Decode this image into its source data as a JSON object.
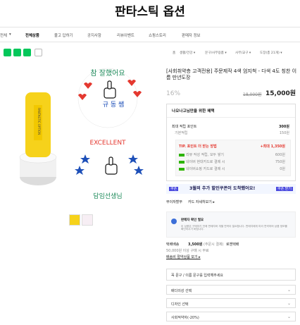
{
  "store": {
    "title": "판타스틱 옵션"
  },
  "nav": [
    "전체상품",
    "불고 답하기",
    "공지사항",
    "리뷰이벤트",
    "쇼핑스토리",
    "판매자 정보"
  ],
  "nav_left": "전체",
  "share_icons": [
    "share-icon",
    "talk-icon",
    "shopping-icon",
    "refresh-icon"
  ],
  "breadcrumb": {
    "home": "홈",
    "items": [
      "생활/건강 ▾",
      "문구/사무용품 ▾",
      "사무/교구 ▾",
      "도장(총 21개) ▾"
    ]
  },
  "image_text": {
    "top": "참 잘했어요",
    "middle": "규 동 쌤",
    "bottom_en": "EXCELLENT",
    "bottom_ko": "담임선생님",
    "stamp_label": "FANTASTIC OPTION"
  },
  "product": {
    "title": "[사회취약층 고객전용] 주문제작 4색 엄지척 - 다색 4도 칭찬 이름 만년도장",
    "discount": "16%",
    "original_price": "18,000원",
    "price": "15,000원"
  },
  "benefit": {
    "header": "나오나고님만을 위한 혜택",
    "points_label": "최대 적립 포인트",
    "points_value": "300원",
    "basic_label": "기본적립",
    "basic_value": "150원",
    "tip": "TIP. 포인트 더 받는 방법",
    "tip_value": "+최대 1,350원",
    "tip_rows": [
      {
        "label": "리뷰 작성 적립, 모두 쌓기",
        "value": "600원"
      },
      {
        "label": "네이버 현대카드로 결제 시",
        "value": "750원"
      },
      {
        "label": "네이버쇼핑 카드로 결제 시",
        "value": "0원"
      }
    ]
  },
  "coupon": {
    "badge": "쿠폰",
    "text": "3월의 추가 할인쿠폰이 도착했어요!",
    "button": "쿠폰 받기"
  },
  "installment": {
    "label": "무이자할부",
    "link": "카드 자세히보기 ▸"
  },
  "notice": {
    "title": "판매자 확인 필요",
    "text": "이 상품은 구매하기 전에 판매자와 개별 연락이 필요합니다. 판매자에게 미리 연락하여 상품 정보를 확인하시기 바랍니다."
  },
  "shipping": {
    "label": "택배배송",
    "price": "3,500원",
    "detail": "(주문시 결제)",
    "company": "로젠택배",
    "note": "50,000원 이상 구매 시 무료",
    "link": "배송비 절약상품 보기 ▸"
  },
  "options": {
    "prompt": "꼭 문구 / 이름 문구를 입력해주세요",
    "selects": [
      "배다의성 선택",
      "디자인 선택",
      "사회적약자(-20%)"
    ]
  },
  "colors": {
    "naver_green": "#03c75a",
    "red": "#e4382f",
    "star_blue": "#1d4fb8",
    "stamp_yellow": "#f6d21b"
  }
}
